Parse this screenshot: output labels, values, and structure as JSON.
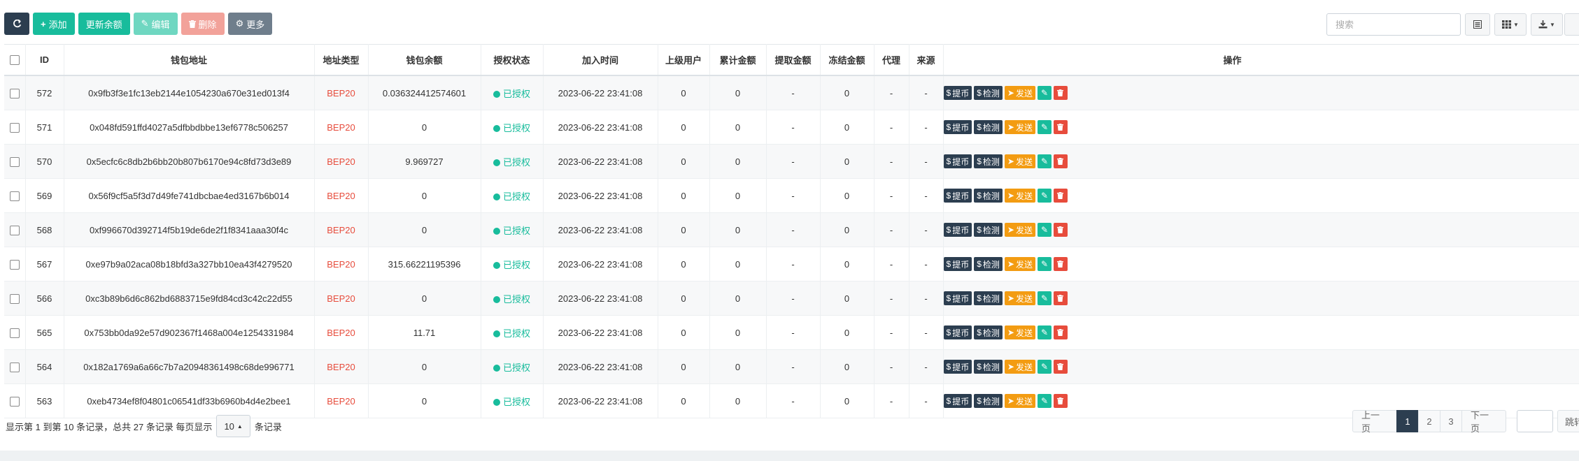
{
  "toolbar": {
    "refresh_icon": "refresh-icon",
    "add_label": "添加",
    "update_balance_label": "更新余额",
    "edit_label": "编辑",
    "delete_label": "删除",
    "more_label": "更多"
  },
  "search": {
    "placeholder": "搜索"
  },
  "table": {
    "headers": [
      "ID",
      "钱包地址",
      "地址类型",
      "钱包余额",
      "授权状态",
      "加入时间",
      "上级用户",
      "累计金额",
      "提取金额",
      "冻结金额",
      "代理",
      "来源",
      "操作"
    ],
    "rows": [
      {
        "id": "572",
        "address": "0x9fb3f3e1fc13eb2144e1054230a670e31ed013f4",
        "type": "BEP20",
        "balance": "0.036324412574601",
        "status": "已授权",
        "time": "2023-06-22 23:41:08",
        "parent": "0",
        "total": "0",
        "withdrawn": "-",
        "frozen": "0",
        "agent": "-",
        "source": "-"
      },
      {
        "id": "571",
        "address": "0x048fd591ffd4027a5dfbbdbbe13ef6778c506257",
        "type": "BEP20",
        "balance": "0",
        "status": "已授权",
        "time": "2023-06-22 23:41:08",
        "parent": "0",
        "total": "0",
        "withdrawn": "-",
        "frozen": "0",
        "agent": "-",
        "source": "-"
      },
      {
        "id": "570",
        "address": "0x5ecfc6c8db2b6bb20b807b6170e94c8fd73d3e89",
        "type": "BEP20",
        "balance": "9.969727",
        "status": "已授权",
        "time": "2023-06-22 23:41:08",
        "parent": "0",
        "total": "0",
        "withdrawn": "-",
        "frozen": "0",
        "agent": "-",
        "source": "-"
      },
      {
        "id": "569",
        "address": "0x56f9cf5a5f3d7d49fe741dbcbae4ed3167b6b014",
        "type": "BEP20",
        "balance": "0",
        "status": "已授权",
        "time": "2023-06-22 23:41:08",
        "parent": "0",
        "total": "0",
        "withdrawn": "-",
        "frozen": "0",
        "agent": "-",
        "source": "-"
      },
      {
        "id": "568",
        "address": "0xf996670d392714f5b19de6de2f1f8341aaa30f4c",
        "type": "BEP20",
        "balance": "0",
        "status": "已授权",
        "time": "2023-06-22 23:41:08",
        "parent": "0",
        "total": "0",
        "withdrawn": "-",
        "frozen": "0",
        "agent": "-",
        "source": "-"
      },
      {
        "id": "567",
        "address": "0xe97b9a02aca08b18bfd3a327bb10ea43f4279520",
        "type": "BEP20",
        "balance": "315.66221195396",
        "status": "已授权",
        "time": "2023-06-22 23:41:08",
        "parent": "0",
        "total": "0",
        "withdrawn": "-",
        "frozen": "0",
        "agent": "-",
        "source": "-"
      },
      {
        "id": "566",
        "address": "0xc3b89b6d6c862bd6883715e9fd84cd3c42c22d55",
        "type": "BEP20",
        "balance": "0",
        "status": "已授权",
        "time": "2023-06-22 23:41:08",
        "parent": "0",
        "total": "0",
        "withdrawn": "-",
        "frozen": "0",
        "agent": "-",
        "source": "-"
      },
      {
        "id": "565",
        "address": "0x753bb0da92e57d902367f1468a004e1254331984",
        "type": "BEP20",
        "balance": "11.71",
        "status": "已授权",
        "time": "2023-06-22 23:41:08",
        "parent": "0",
        "total": "0",
        "withdrawn": "-",
        "frozen": "0",
        "agent": "-",
        "source": "-"
      },
      {
        "id": "564",
        "address": "0x182a1769a6a66c7b7a20948361498c68de996771",
        "type": "BEP20",
        "balance": "0",
        "status": "已授权",
        "time": "2023-06-22 23:41:08",
        "parent": "0",
        "total": "0",
        "withdrawn": "-",
        "frozen": "0",
        "agent": "-",
        "source": "-"
      },
      {
        "id": "563",
        "address": "0xeb4734ef8f04801c06541df33b6960b4d4e2bee1",
        "type": "BEP20",
        "balance": "0",
        "status": "已授权",
        "time": "2023-06-22 23:41:08",
        "parent": "0",
        "total": "0",
        "withdrawn": "-",
        "frozen": "0",
        "agent": "-",
        "source": "-"
      }
    ],
    "row_actions": {
      "withdraw_label": "提币",
      "check_label": "检测",
      "send_label": "发送"
    }
  },
  "footer": {
    "summary": "显示第 1 到第 10 条记录，总共 27 条记录 每页显示",
    "page_size": "10",
    "suffix": "条记录"
  },
  "pagination": {
    "prev": "上一页",
    "pages": [
      "1",
      "2",
      "3"
    ],
    "active_page": "1",
    "next": "下一页",
    "jump_label": "跳转"
  },
  "colors": {
    "primary_dark": "#2c3e50",
    "success": "#18bc9c",
    "danger": "#e74c3c",
    "warning": "#f39c12"
  }
}
